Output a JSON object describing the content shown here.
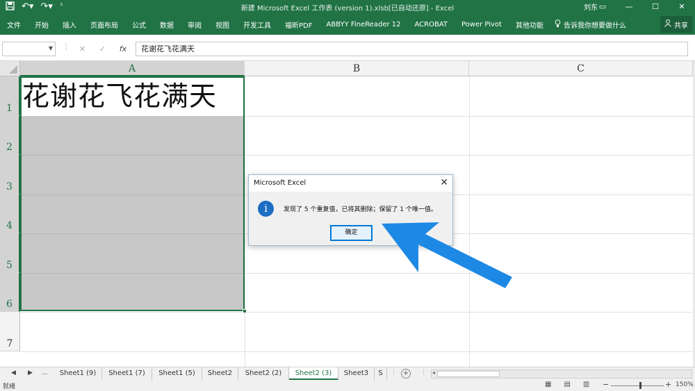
{
  "titlebar": {
    "title": "新建 Microsoft Excel 工作表 (version 1).xlsb[已自动还原] - Excel",
    "user": "刘东",
    "save_icon": "save-icon",
    "undo_icon": "undo-icon",
    "redo_icon": "redo-icon"
  },
  "ribbon": {
    "tabs": [
      "文件",
      "开始",
      "插入",
      "页面布局",
      "公式",
      "数据",
      "审阅",
      "视图",
      "开发工具",
      "福昕PDF",
      "ABBYY FineReader 12",
      "ACROBAT",
      "Power Pivot",
      "其他功能"
    ],
    "tell_me": "告诉我你想要做什么",
    "share": "共享",
    "accent": "#217346"
  },
  "formula_bar": {
    "name_box": "",
    "cancel": "✕",
    "enter": "✓",
    "fx": "fx",
    "content": "花谢花飞花满天"
  },
  "grid": {
    "columns": [
      "A",
      "B",
      "C"
    ],
    "rows": [
      "1",
      "2",
      "3",
      "4",
      "5",
      "6",
      "7"
    ],
    "cell_a1": "花谢花飞花满天"
  },
  "dialog": {
    "title": "Microsoft Excel",
    "message": "发现了 5 个重复值，已将其删除；保留了 1 个唯一值。",
    "ok": "确定",
    "info_glyph": "i"
  },
  "sheets": {
    "ellipsis": "...",
    "tabs": [
      "Sheet1 (9)",
      "Sheet1 (7)",
      "Sheet1 (5)",
      "Sheet2",
      "Sheet2 (2)",
      "Sheet2 (3)",
      "Sheet3",
      "S"
    ],
    "active_index": 5,
    "add": "+"
  },
  "status": {
    "ready": "就绪",
    "zoom": "150%"
  }
}
